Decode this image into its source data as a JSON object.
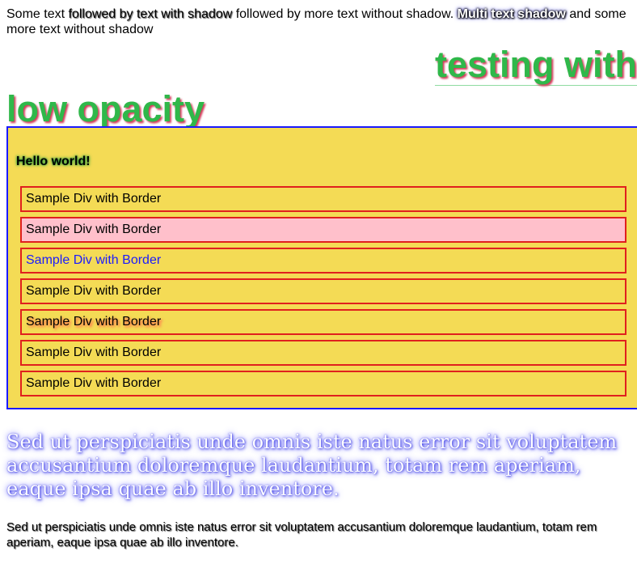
{
  "intro": {
    "text1": "Some text ",
    "shadow_text": "followed by text with shadow",
    "text2": " followed by more text without shadow. ",
    "multi_shadow": "Multi text shadow",
    "text3": " and some more text without shadow"
  },
  "opacity_heading": {
    "line1": "testing with",
    "line2": "low opacity"
  },
  "box": {
    "hello": "Hello world!",
    "samples": [
      "Sample Div with Border",
      "Sample Div with Border",
      "Sample Div with Border",
      "Sample Div with Border",
      "Sample Div with Border",
      "Sample Div with Border",
      "Sample Div with Border"
    ]
  },
  "serif_paragraph": "Sed ut perspiciatis unde omnis iste natus error sit voluptatem accusantium doloremque laudantium, totam rem aperiam, eaque ipsa quae ab illo inventore.",
  "small_paragraph": "Sed ut perspiciatis unde omnis iste natus error sit voluptatem accusantium doloremque laudantium, totam rem aperiam, eaque ipsa quae ab illo inventore.",
  "colors": {
    "box_background": "#f4db55",
    "box_border": "#1a1aff",
    "sample_border": "#e0201e",
    "pink_background": "#ffc0cb",
    "heading_green": "#2fb84a"
  }
}
